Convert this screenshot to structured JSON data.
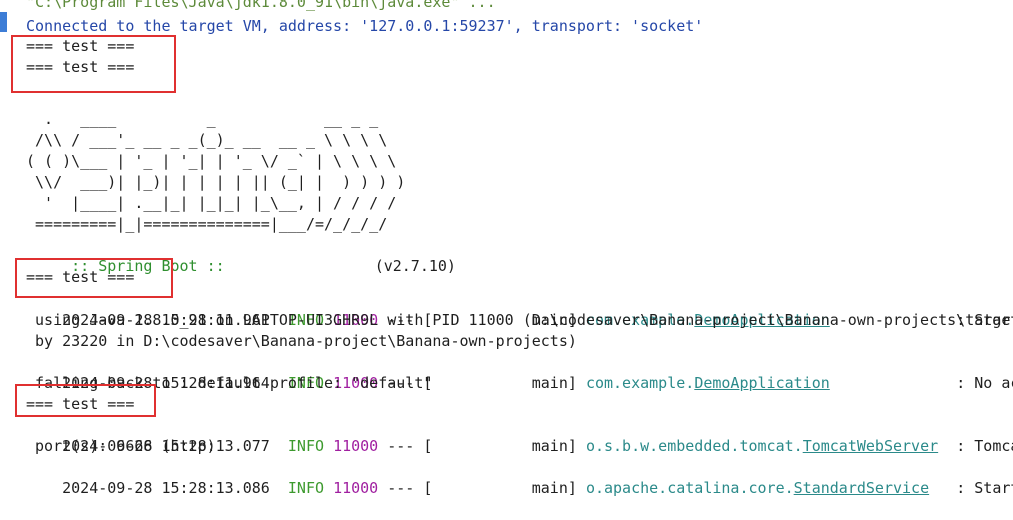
{
  "console": {
    "cmd_line": "\"C:\\Program Files\\Java\\jdk1.8.0_91\\bin\\java.exe\" ...",
    "connected": "Connected to the target VM, address: '127.0.0.1:59237', transport: 'socket'",
    "test1": "=== test ===",
    "test2": "=== test ===",
    "banner": [
      "  .   ____          _            __ _ _",
      " /\\\\ / ___'_ __ _ _(_)_ __  __ _ \\ \\ \\ \\",
      "( ( )\\___ | '_ | '_| | '_ \\/ _` | \\ \\ \\ \\",
      " \\\\/  ___)| |_)| | | | | || (_| |  ) ) ) )",
      "  '  |____| .__|_| |_|_| |_\\__, | / / / /",
      " =========|_|==============|___/=/_/_/_/"
    ],
    "spring_label": " :: Spring Boot ::",
    "spring_version": "(v2.7.10)",
    "test3": "=== test ===",
    "log1": {
      "ts": "2024-09-28 15:28:11.961",
      "level": "INFO",
      "pid": "11000",
      "sep": " --- [           main] ",
      "logger_prefix": "com.example.",
      "logger_link": "DemoApplication",
      "msg": "              : Starting",
      "cont1": " using Java 1.8.0_91 on LAPTOP-UI3GHR9L with PID 11000 (D:\\codesaver\\Banana-project\\Banana-own-projects\\target",
      "cont2": " by 23220 in D:\\codesaver\\Banana-project\\Banana-own-projects)"
    },
    "log2": {
      "ts": "2024-09-28 15:28:11.964",
      "level": "INFO",
      "pid": "11000",
      "sep": " --- [           main] ",
      "logger_prefix": "com.example.",
      "logger_link": "DemoApplication",
      "msg": "              : No active",
      "cont1": " falling back to 1 default profile: \"default\""
    },
    "test4": "=== test ===",
    "log3": {
      "ts": "2024-09-28 15:28:13.077",
      "level": "INFO",
      "pid": "11000",
      "sep": " --- [           main] ",
      "logger_prefix": "o.s.b.w.embedded.tomcat.",
      "logger_link": "TomcatWebServer",
      "msg": "  : Tomcat in",
      "cont1": " port(s): 6666 (http)"
    },
    "log4": {
      "ts": "2024-09-28 15:28:13.086",
      "level": "INFO",
      "pid": "11000",
      "sep": " --- [           main] ",
      "logger_prefix": "o.apache.catalina.core.",
      "logger_link": "StandardService",
      "msg": "   : Starting"
    }
  },
  "colors": {
    "highlight_box": "#e03030",
    "gutter_marker": "#3d7dd6",
    "info": "#3d9a2e",
    "pid": "#a01fa0",
    "logger": "#2b8a8a"
  }
}
